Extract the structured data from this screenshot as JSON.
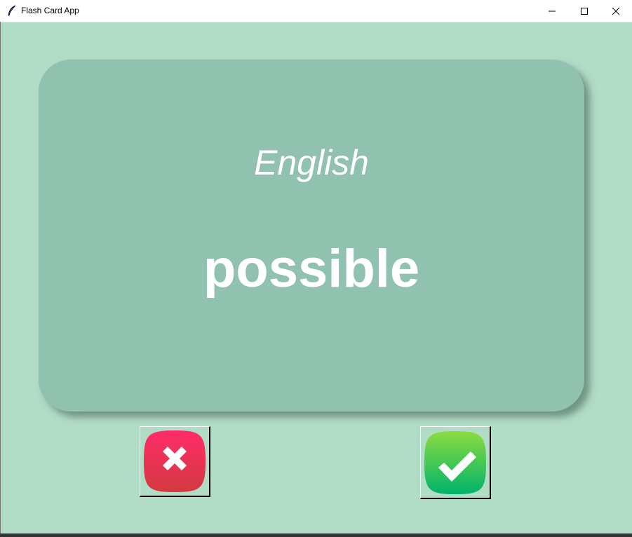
{
  "window": {
    "title": "Flash Card App",
    "app_icon": "feather-icon"
  },
  "window_controls": [
    "minimize-icon",
    "maximize-icon",
    "close-icon"
  ],
  "card": {
    "language": "English",
    "word": "possible",
    "color": "#91c1af"
  },
  "background_color": "#b1dcc6",
  "buttons": {
    "wrong": {
      "icon": "x-icon",
      "color": "#f0305f"
    },
    "right": {
      "icon": "check-icon",
      "color": "#33c45a"
    }
  }
}
